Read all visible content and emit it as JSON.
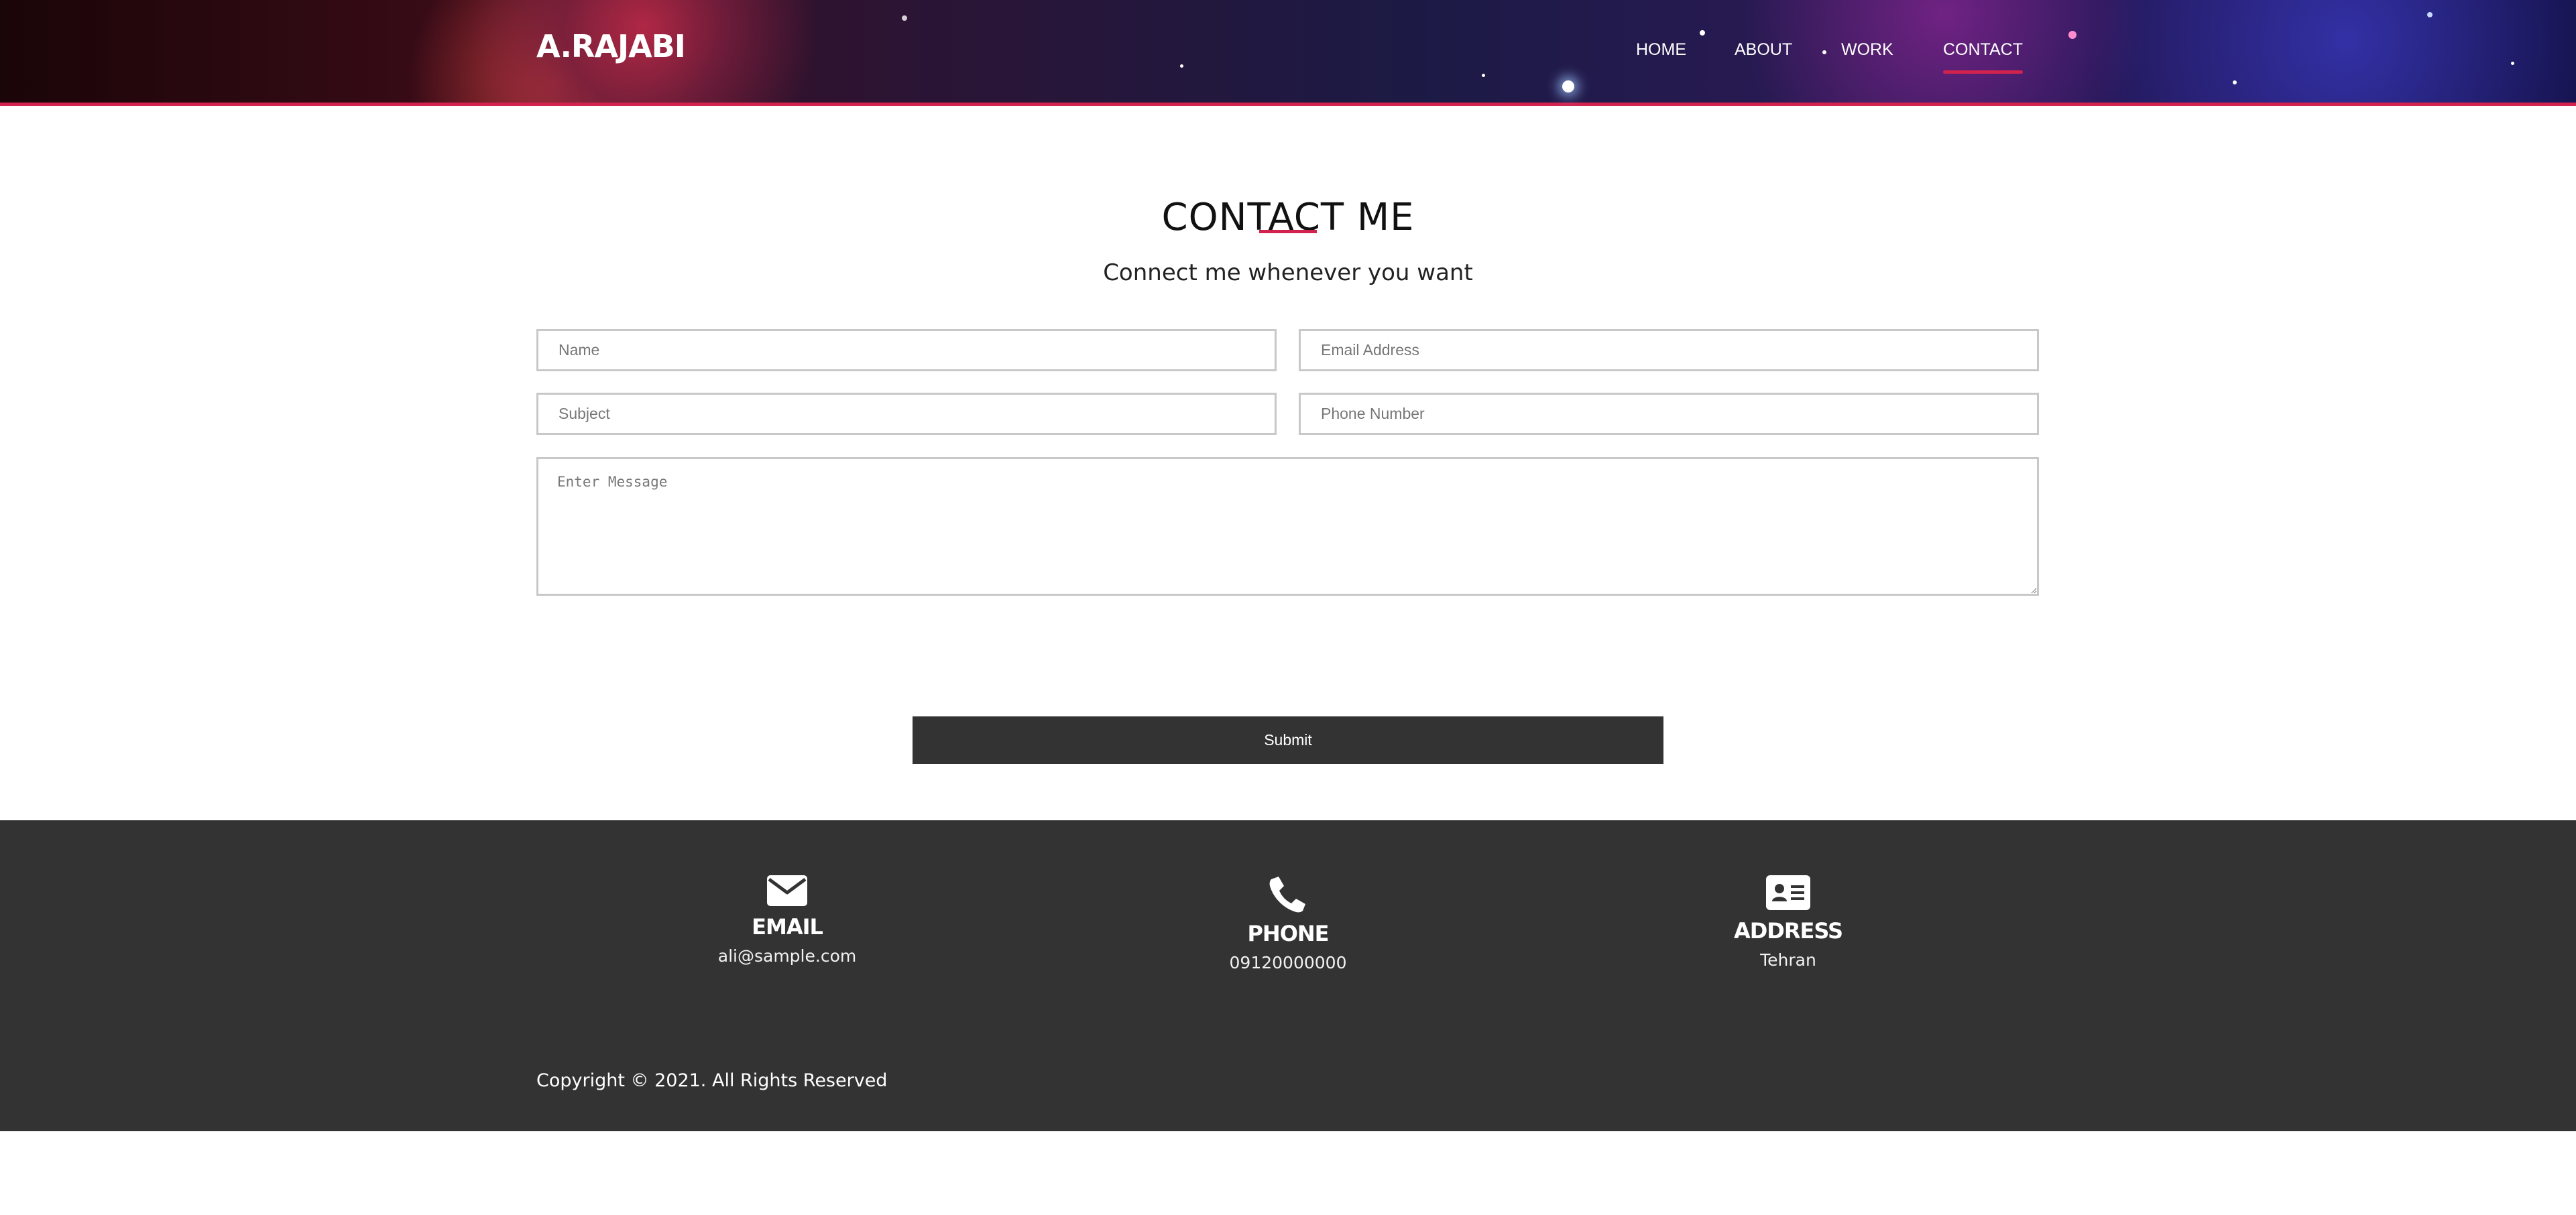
{
  "header": {
    "logo": "A.RAJABI",
    "nav": [
      {
        "label": "HOME"
      },
      {
        "label": "ABOUT"
      },
      {
        "label": "WORK"
      },
      {
        "label": "CONTACT"
      }
    ],
    "active_nav": "CONTACT",
    "accent_color": "#d2234e"
  },
  "contact": {
    "title": "CONTACT ME",
    "subtitle": "Connect me whenever you want",
    "form": {
      "name_placeholder": "Name",
      "email_placeholder": "Email Address",
      "subject_placeholder": "Subject",
      "phone_placeholder": "Phone Number",
      "message_placeholder": "Enter Message",
      "submit_label": "Submit"
    }
  },
  "footer": {
    "items": [
      {
        "icon": "envelope-icon",
        "title": "EMAIL",
        "value": "ali@sample.com"
      },
      {
        "icon": "phone-icon",
        "title": "PHONE",
        "value": "09120000000"
      },
      {
        "icon": "address-card-icon",
        "title": "ADDRESS",
        "value": "Tehran"
      }
    ],
    "copyright": "Copyright © 2021. All Rights Reserved",
    "background_color": "#333333"
  }
}
